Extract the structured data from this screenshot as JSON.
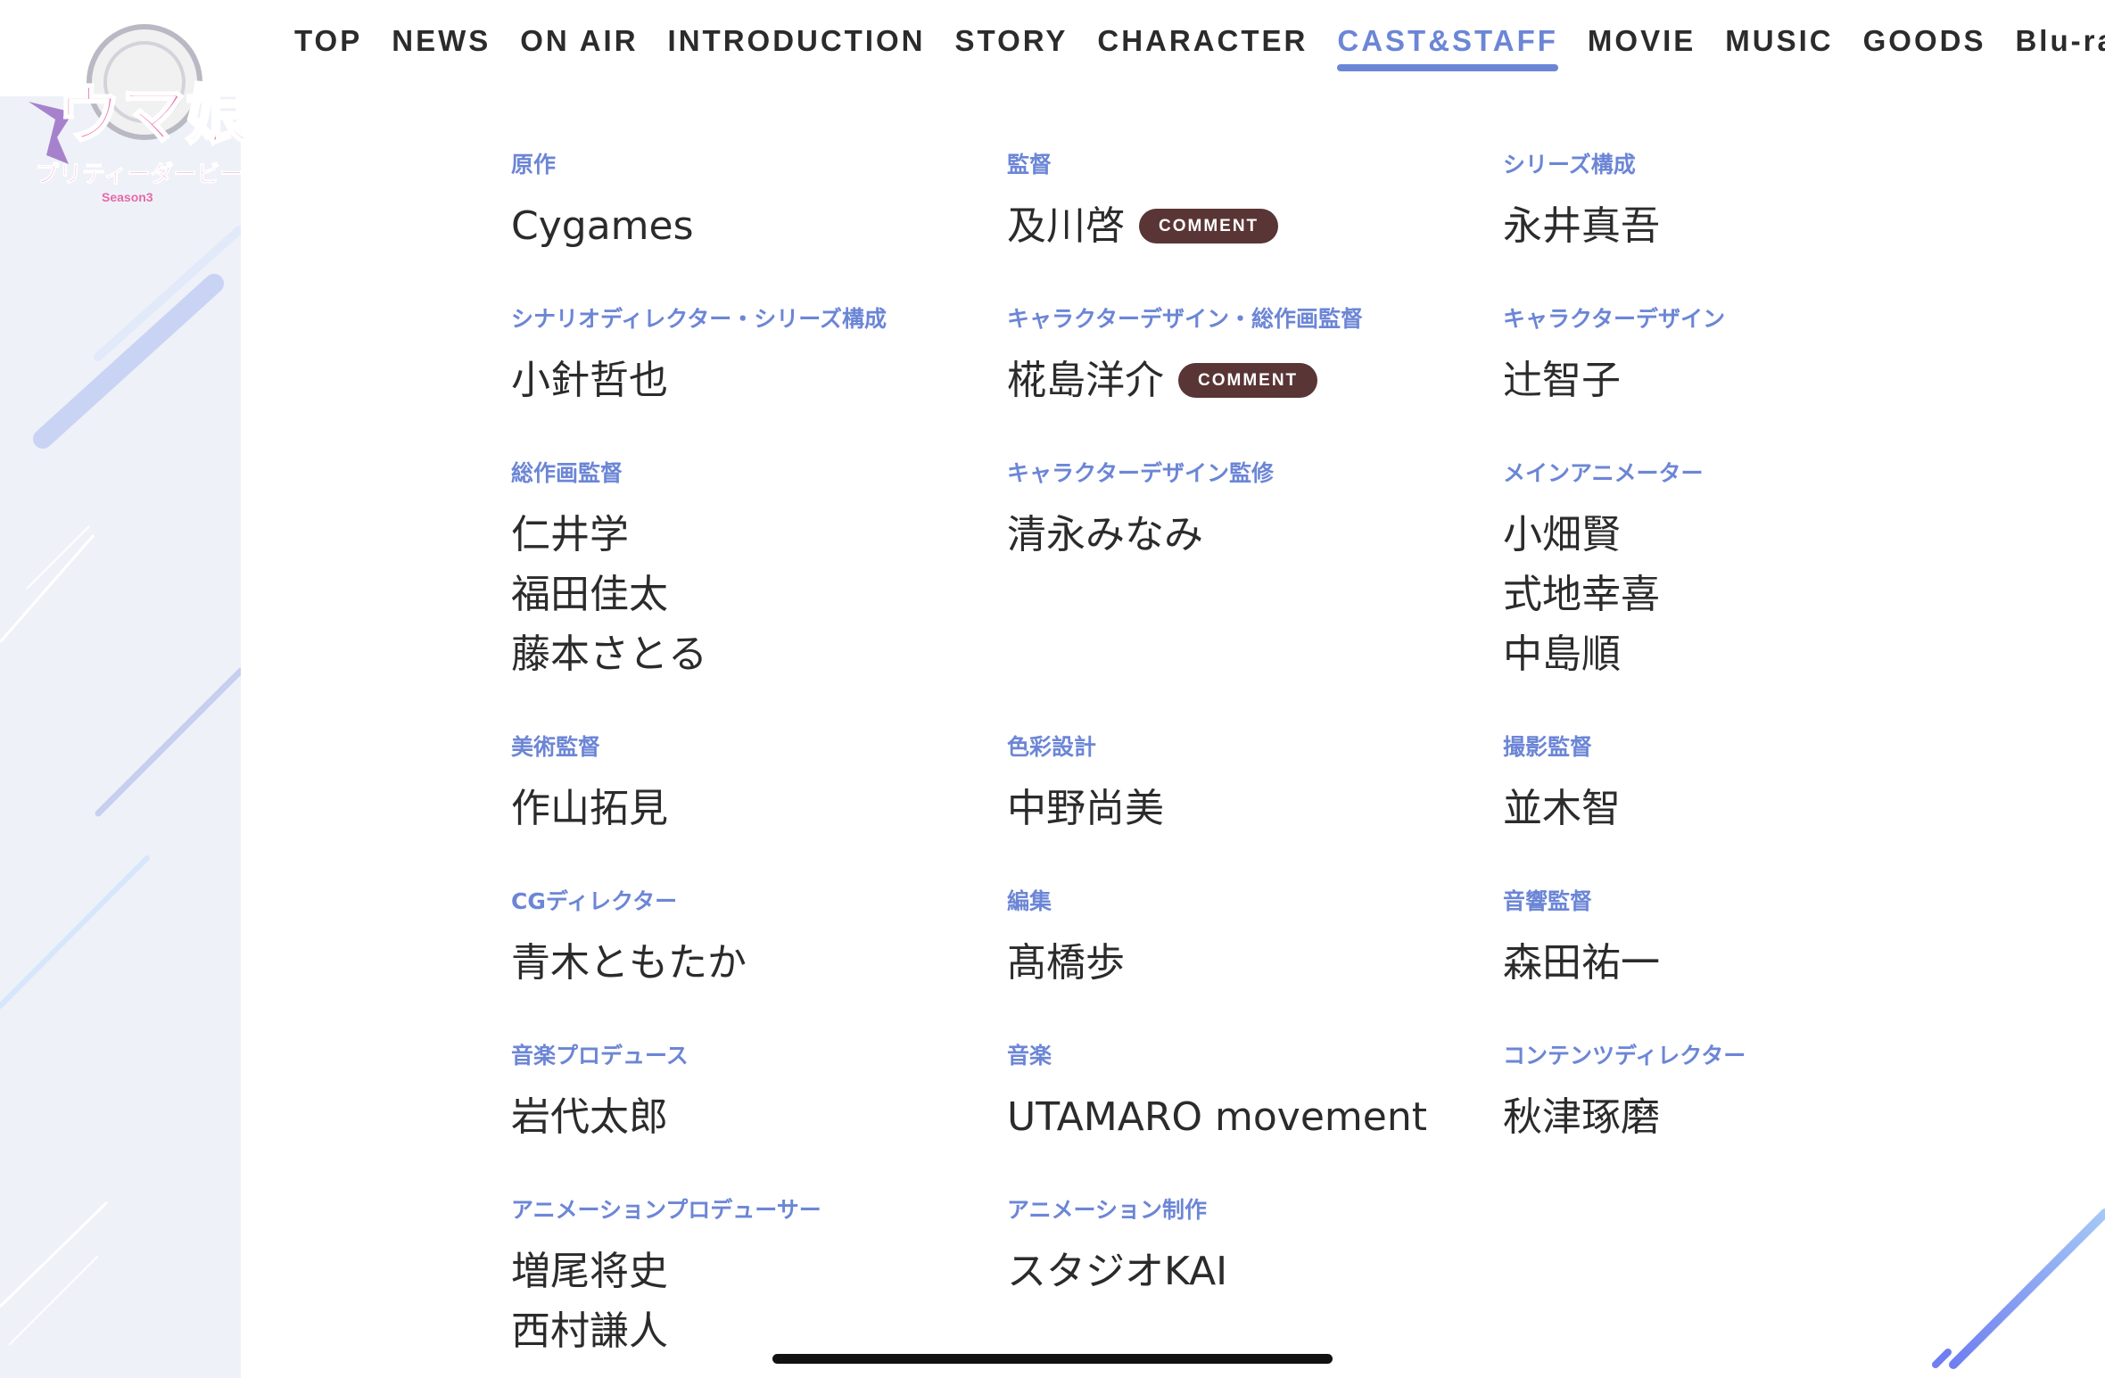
{
  "logo": {
    "title": "ウマ娘",
    "subtitle": "プリティーダービー",
    "season": "Season3"
  },
  "nav": {
    "items": [
      {
        "label": "TOP",
        "active": false
      },
      {
        "label": "NEWS",
        "active": false
      },
      {
        "label": "ON AIR",
        "active": false
      },
      {
        "label": "INTRODUCTION",
        "active": false
      },
      {
        "label": "STORY",
        "active": false
      },
      {
        "label": "CHARACTER",
        "active": false
      },
      {
        "label": "CAST&STAFF",
        "active": true
      },
      {
        "label": "MOVIE",
        "active": false
      },
      {
        "label": "MUSIC",
        "active": false
      },
      {
        "label": "GOODS",
        "active": false
      },
      {
        "label": "Blu-ray",
        "active": false
      }
    ]
  },
  "staff": [
    {
      "role": "原作",
      "names": [
        "Cygames"
      ]
    },
    {
      "role": "監督",
      "names": [
        "及川啓"
      ],
      "comment": "COMMENT"
    },
    {
      "role": "シリーズ構成",
      "names": [
        "永井真吾"
      ]
    },
    {
      "role": "シナリオディレクター・シリーズ構成",
      "names": [
        "小針哲也"
      ]
    },
    {
      "role": "キャラクターデザイン・総作画監督",
      "names": [
        "椛島洋介"
      ],
      "comment": "COMMENT"
    },
    {
      "role": "キャラクターデザイン",
      "names": [
        "辻智子"
      ]
    },
    {
      "role": "総作画監督",
      "names": [
        "仁井学",
        "福田佳太",
        "藤本さとる"
      ]
    },
    {
      "role": "キャラクターデザイン監修",
      "names": [
        "清永みなみ"
      ]
    },
    {
      "role": "メインアニメーター",
      "names": [
        "小畑賢",
        "式地幸喜",
        "中島順"
      ]
    },
    {
      "role": "美術監督",
      "names": [
        "作山拓見"
      ]
    },
    {
      "role": "色彩設計",
      "names": [
        "中野尚美"
      ]
    },
    {
      "role": "撮影監督",
      "names": [
        "並木智"
      ]
    },
    {
      "role": "CGディレクター",
      "names": [
        "青木ともたか"
      ]
    },
    {
      "role": "編集",
      "names": [
        "髙橋歩"
      ]
    },
    {
      "role": "音響監督",
      "names": [
        "森田祐一"
      ]
    },
    {
      "role": "音楽プロデュース",
      "names": [
        "岩代太郎"
      ]
    },
    {
      "role": "音楽",
      "names": [
        "UTAMARO movement"
      ]
    },
    {
      "role": "コンテンツディレクター",
      "names": [
        "秋津琢磨"
      ]
    },
    {
      "role": "アニメーションプロデューサー",
      "names": [
        "増尾将史",
        "西村謙人"
      ]
    },
    {
      "role": "アニメーション制作",
      "names": [
        "スタジオKAI"
      ]
    }
  ],
  "colors": {
    "accent": "#6c86d6",
    "comment_bg": "#5a3535",
    "sidebar_bg": "#eff1f8"
  }
}
